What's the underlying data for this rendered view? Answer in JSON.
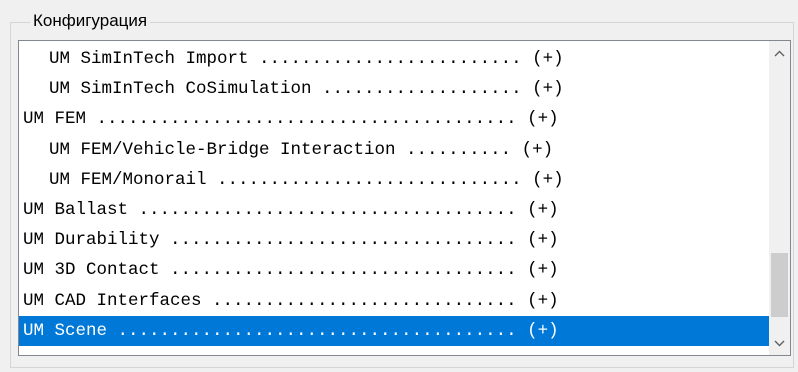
{
  "group": {
    "title": "Конфигурация"
  },
  "list": {
    "items": [
      {
        "label": "UM SimInTech Import ......................... (+)",
        "indent": true,
        "selected": false
      },
      {
        "label": "UM SimInTech CoSimulation ................... (+)",
        "indent": true,
        "selected": false
      },
      {
        "label": "UM FEM ........................................ (+)",
        "indent": false,
        "selected": false
      },
      {
        "label": "UM FEM/Vehicle-Bridge Interaction .......... (+)",
        "indent": true,
        "selected": false
      },
      {
        "label": "UM FEM/Monorail ............................. (+)",
        "indent": true,
        "selected": false
      },
      {
        "label": "UM Ballast .................................... (+)",
        "indent": false,
        "selected": false
      },
      {
        "label": "UM Durability ................................. (+)",
        "indent": false,
        "selected": false
      },
      {
        "label": "UM 3D Contact ................................. (+)",
        "indent": false,
        "selected": false
      },
      {
        "label": "UM CAD Interfaces ............................. (+)",
        "indent": false,
        "selected": false
      },
      {
        "label": "UM Scene ...................................... (+)",
        "indent": false,
        "selected": true
      }
    ]
  },
  "scrollbar": {
    "up_icon": "chevron-up-icon",
    "down_icon": "chevron-down-icon",
    "position_fraction": 0.93,
    "visible_fraction": 0.24
  },
  "colors": {
    "selection": "#0078d7",
    "thumb": "#cdcdcd"
  }
}
